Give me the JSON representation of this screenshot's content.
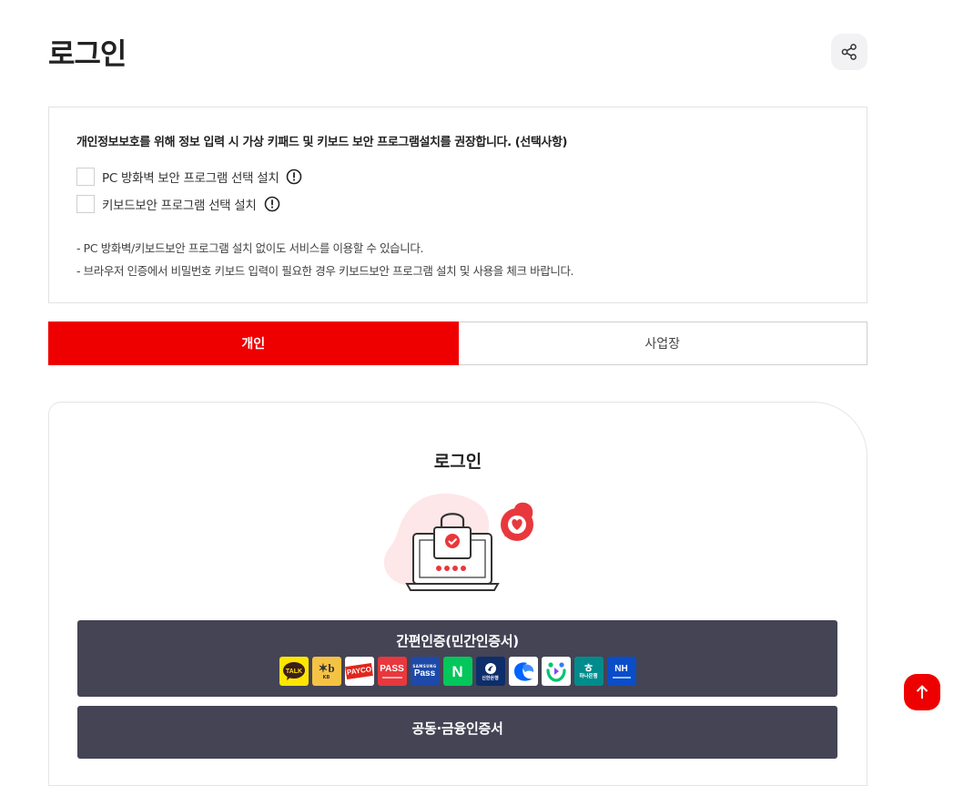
{
  "page": {
    "title": "로그인"
  },
  "share": {
    "icon": "share-icon"
  },
  "security_notice": {
    "heading": "개인정보보호를 위해 정보 입력 시 가상 키패드 및 키보드 보안 프로그램설치를 권장합니다. (선택사항)",
    "options": [
      {
        "label": "PC 방화벽 보안 프로그램 선택 설치",
        "checked": false
      },
      {
        "label": "키보드보안 프로그램 선택 설치",
        "checked": false
      }
    ],
    "notes": [
      "- PC 방화벽/키보드보안 프로그램 설치 없이도 서비스를 이용할 수 있습니다.",
      "- 브라우저 인증에서 비밀번호 키보드 입력이 필요한 경우 키보드보안 프로그램 설치 및 사용을 체크 바랍니다."
    ]
  },
  "tabs": [
    {
      "label": "개인",
      "active": true
    },
    {
      "label": "사업장",
      "active": false
    }
  ],
  "login_card": {
    "title": "로그인",
    "simple_auth": {
      "label": "간편인증(민간인증서)",
      "providers": [
        {
          "name": "kakao",
          "text": "TALK",
          "bg": "#fee500",
          "fg": "#3c1e1e"
        },
        {
          "name": "kb",
          "text": "KB",
          "bg": "#f5c344",
          "fg": "#333333"
        },
        {
          "name": "payco",
          "text": "PAYCO",
          "bg": "#ffffff",
          "fg": "#e1251b"
        },
        {
          "name": "pass",
          "text": "PASS",
          "bg": "#e8383d",
          "fg": "#ffffff"
        },
        {
          "name": "samsung-pass",
          "text": "Pass",
          "bg": "#1d4aa8",
          "fg": "#ffffff"
        },
        {
          "name": "naver",
          "text": "N",
          "bg": "#03c75a",
          "fg": "#ffffff"
        },
        {
          "name": "shinhan",
          "text": "신한은행",
          "bg": "#0d2d6b",
          "fg": "#ffffff"
        },
        {
          "name": "toss",
          "text": "",
          "bg": "#ffffff",
          "fg": "#0064ff"
        },
        {
          "name": "banksalad",
          "text": "",
          "bg": "#ffffff",
          "fg": "#00c471"
        },
        {
          "name": "hana",
          "text": "하나은행",
          "bg": "#008c8c",
          "fg": "#ffffff"
        },
        {
          "name": "nh",
          "text": "NH",
          "bg": "#0a4dc9",
          "fg": "#ffffff"
        }
      ]
    },
    "cert_auth": {
      "label": "공동·금융인증서"
    }
  },
  "scroll_top": {
    "icon": "arrow-up-icon"
  },
  "colors": {
    "accent": "#ee0000",
    "dark_button": "#444455"
  }
}
